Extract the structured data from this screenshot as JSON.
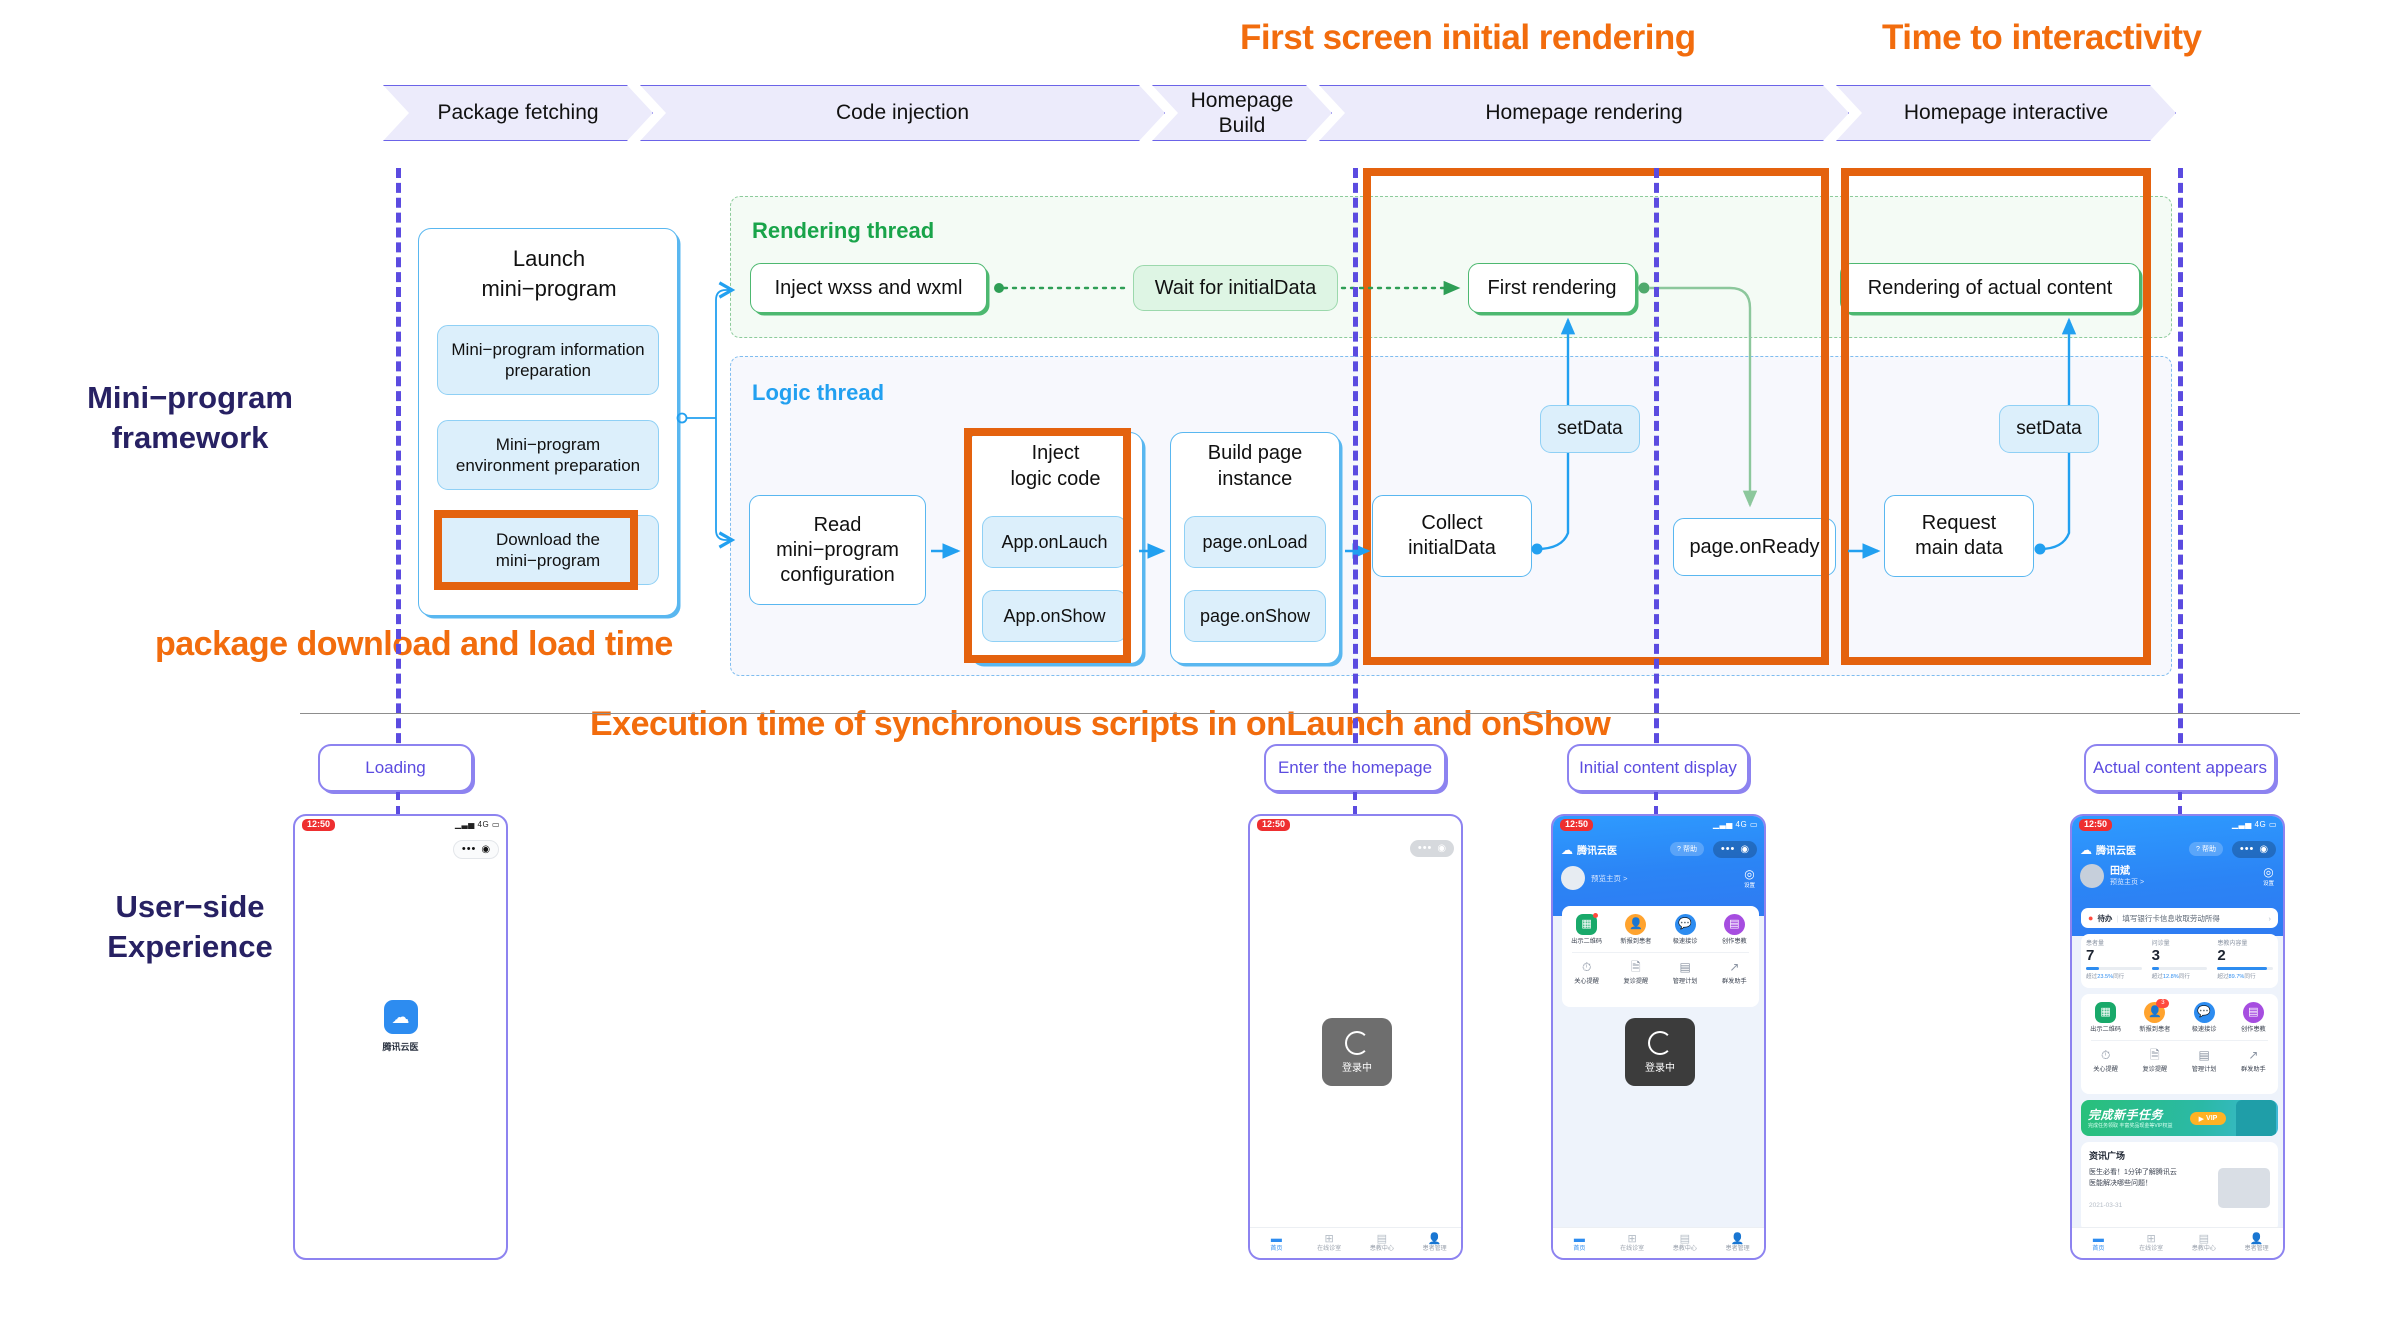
{
  "headlines": {
    "first_screen": "First screen initial rendering",
    "time_to_interactivity": "Time to interactivity",
    "code_injection": "Code injection",
    "package_download": "package download and load time",
    "execution_time": "Execution time of synchronous scripts in onLaunch and onShow"
  },
  "timeline": {
    "stages": [
      {
        "label": "Package fetching"
      },
      {
        "label": "Code injection"
      },
      {
        "label": "Homepage\nBuild"
      },
      {
        "label": "Homepage rendering"
      },
      {
        "label": "Homepage interactive"
      }
    ]
  },
  "side_labels": {
    "framework": "Mini−program\nframework",
    "user_side": "User−side\nExperience"
  },
  "threads": {
    "rendering_label": "Rendering thread",
    "logic_label": "Logic thread"
  },
  "launch_group": {
    "title": "Launch\nmini−program",
    "steps": [
      {
        "label": "Mini−program information\npreparation"
      },
      {
        "label": "Mini−program\nenvironment preparation"
      },
      {
        "label": "Download the\nmini−program",
        "highlighted": true
      }
    ]
  },
  "rendering_nodes": [
    {
      "id": "inject-wxss-wxml",
      "label": "Inject wxss and wxml"
    },
    {
      "id": "wait-initialdata",
      "label": "Wait for initialData"
    },
    {
      "id": "first-rendering",
      "label": "First rendering"
    },
    {
      "id": "rendering-actual-content",
      "label": "Rendering of actual content"
    }
  ],
  "logic_nodes": {
    "read_config": "Read\nmini−program\nconfiguration",
    "inject_logic_code": {
      "title": "Inject\nlogic code",
      "items": [
        "App.onLauch",
        "App.onShow"
      ],
      "highlighted": true
    },
    "build_page_instance": {
      "title": "Build page\ninstance",
      "items": [
        "page.onLoad",
        "page.onShow"
      ]
    },
    "collect_initialdata": "Collect\ninitialData",
    "page_onready": "page.onReady",
    "request_main_data": "Request\nmain data",
    "set_data_1": "setData",
    "set_data_2": "setData"
  },
  "phone_callouts": [
    {
      "label": "Loading"
    },
    {
      "label": "Enter the homepage"
    },
    {
      "label": "Initial content display"
    },
    {
      "label": "Actual content appears"
    }
  ],
  "phones": {
    "status_time": "12:50",
    "status_signal": "4G",
    "splash": {
      "app_name": "腾讯云医"
    },
    "loading_text": "登录中",
    "tabbar": [
      {
        "label": "首页",
        "icon": "home-icon",
        "active": true
      },
      {
        "label": "在线诊室",
        "icon": "plus-square-icon",
        "active": false
      },
      {
        "label": "患教中心",
        "icon": "document-icon",
        "active": false
      },
      {
        "label": "患者管理",
        "icon": "person-icon",
        "active": false
      }
    ],
    "brand": "腾讯云医",
    "help_label": "帮助",
    "settings_label": "设置",
    "preview_home": "预览主页 >",
    "user_name": "田斌",
    "todo": {
      "tag": "待办",
      "text": "填写银行卡信息收取劳动所得"
    },
    "stats": [
      {
        "label": "患者量",
        "value": "7",
        "sub_prefix": "超过",
        "sub_value": "23.5%",
        "sub_suffix": "同行",
        "bar_pct": 24
      },
      {
        "label": "问诊量",
        "value": "3",
        "sub_prefix": "超过",
        "sub_value": "12.8%",
        "sub_suffix": "同行",
        "bar_pct": 13
      },
      {
        "label": "患教内容量",
        "value": "2",
        "sub_prefix": "超过",
        "sub_value": "89.7%",
        "sub_suffix": "同行",
        "bar_pct": 90
      }
    ],
    "apps_row1": [
      {
        "label": "出示二维码",
        "color": "#19A96A",
        "icon": "qr-icon",
        "badge": "dot"
      },
      {
        "label": "新报到患者",
        "color": "#FFA32E",
        "icon": "user-add-icon",
        "badge": "3"
      },
      {
        "label": "极速接诊",
        "color": "#2D8CF0",
        "icon": "chat-icon"
      },
      {
        "label": "创作患教",
        "color": "#A64DE0",
        "icon": "list-icon"
      }
    ],
    "apps_row2": [
      {
        "label": "关心提醒",
        "icon": "clock-icon"
      },
      {
        "label": "复诊提醒",
        "icon": "file-icon"
      },
      {
        "label": "管理计划",
        "icon": "plan-icon"
      },
      {
        "label": "群发助手",
        "icon": "share-icon"
      }
    ],
    "banner": {
      "title": "完成新手任务",
      "subtitle": "完成任务领取 丰富奖品现金等VIP权益",
      "chip": "VIP"
    },
    "news": {
      "title": "资讯广场",
      "body": "医生必看！1分钟了解腾讯云\n医能解决哪些问题！",
      "date": "2021-03-31"
    }
  },
  "colors": {
    "orange": "#F26C0D",
    "highlight_orange": "#E4620E",
    "purple": "#5B4BE0",
    "deep_purple": "#272163",
    "green": "#19A44A",
    "blue": "#22A0F0",
    "chevron_fill": "#ECEBFB",
    "chevron_border": "#6B63E8"
  }
}
